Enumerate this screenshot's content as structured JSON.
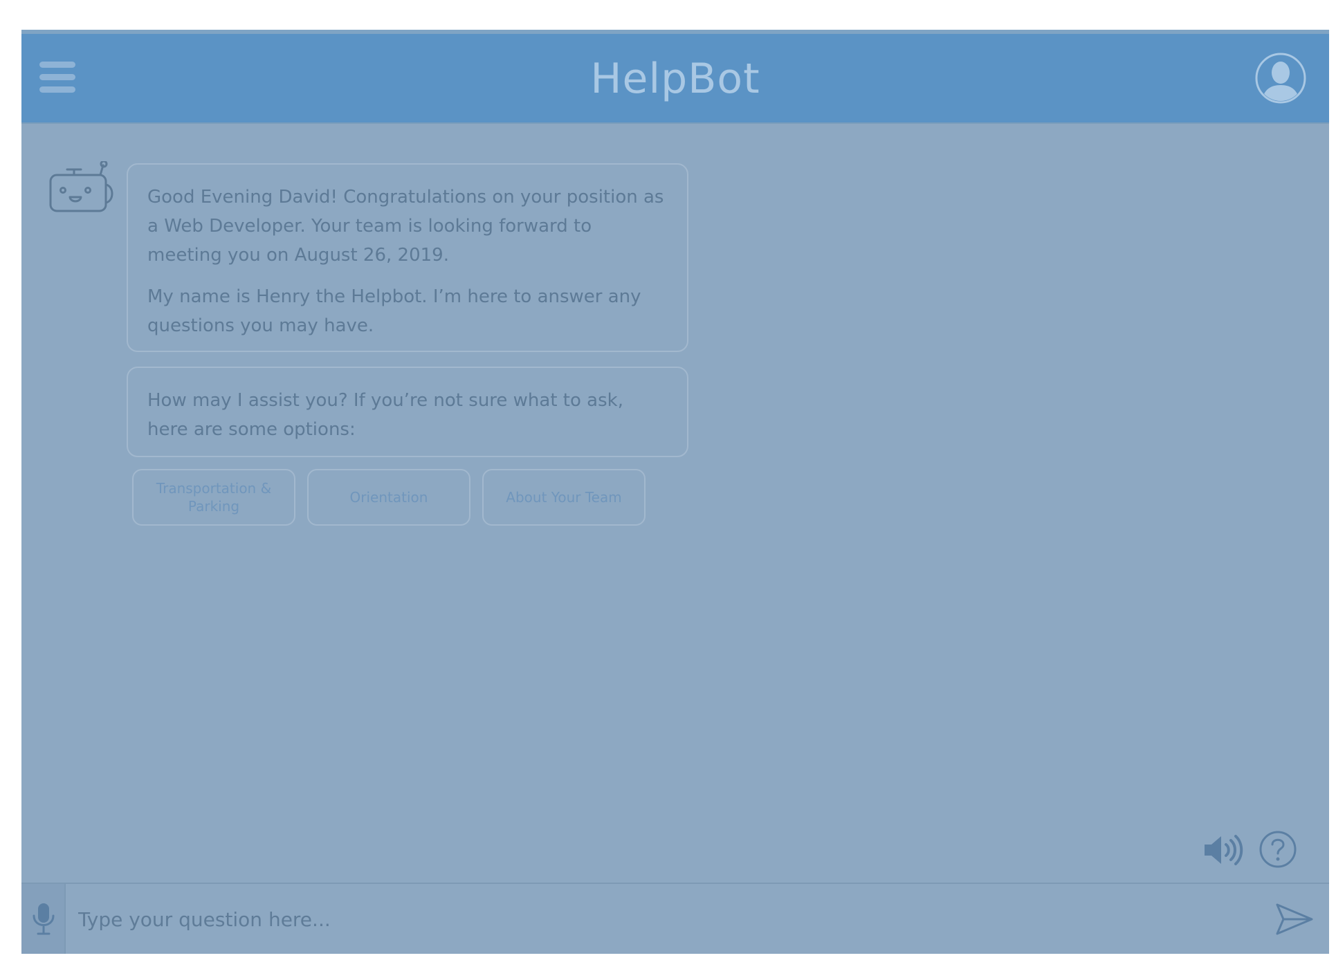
{
  "header": {
    "title": "HelpBot"
  },
  "messages": [
    {
      "paragraphs": [
        "Good Evening David! Congratulations on your position as a Web Developer. Your team is looking forward to meeting you on August 26, 2019.",
        "My name is Henry the Helpbot. I’m here to answer any questions you may have."
      ]
    },
    {
      "paragraphs": [
        "How may I assist you? If you’re not sure what to ask, here are some options:"
      ]
    }
  ],
  "options": [
    "Transportation & Parking",
    "Orientation",
    "About Your Team"
  ],
  "input": {
    "placeholder": "Type your question here..."
  },
  "icons": {
    "menu": "hamburger-menu-icon",
    "user": "user-avatar-icon",
    "bot": "robot-icon",
    "sound": "speaker-icon",
    "help": "question-mark-icon",
    "mic": "microphone-icon",
    "send": "send-icon"
  },
  "colors": {
    "header": "#5b93c5",
    "overlay": "#8da8c2",
    "text": "#5d7a96",
    "option_text": "#7096bc"
  }
}
